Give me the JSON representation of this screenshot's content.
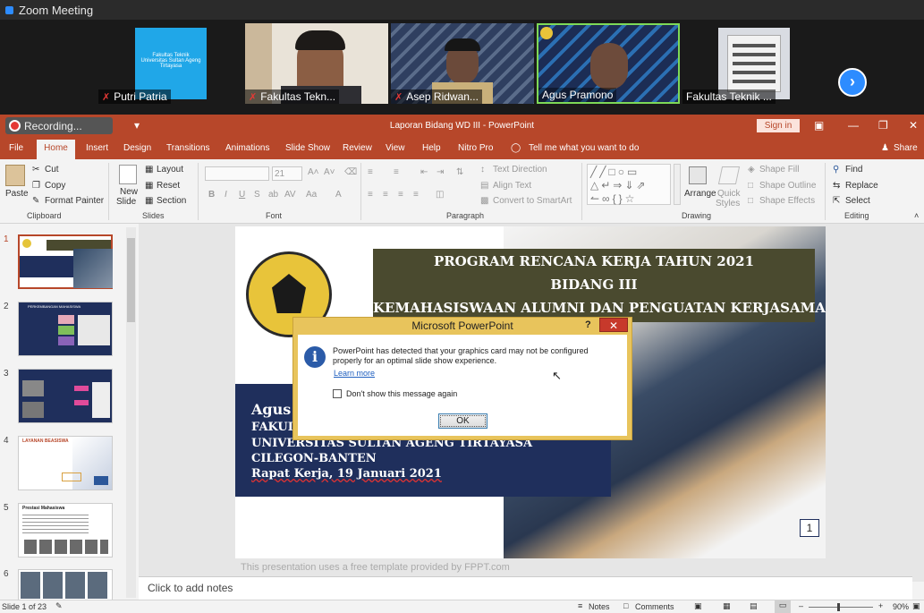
{
  "zoom": {
    "title": "Zoom Meeting",
    "participants": [
      {
        "name": "Putri Patria",
        "slide_text": "Fakultas Teknik Universitas Sultan Ageng Tirtayasa"
      },
      {
        "name": "Fakultas Tekn..."
      },
      {
        "name": "Asep Ridwan..."
      },
      {
        "name": "Agus Pramono"
      },
      {
        "name": "Fakultas Teknik ..."
      }
    ]
  },
  "powerpoint": {
    "recording_label": "Recording...",
    "window_title": "Laporan Bidang WD III  -  PowerPoint",
    "sign_in": "Sign in",
    "tabs": [
      "File",
      "Home",
      "Insert",
      "Design",
      "Transitions",
      "Animations",
      "Slide Show",
      "Review",
      "View",
      "Help",
      "Nitro Pro"
    ],
    "tell_me": "Tell me what you want to do",
    "share": "Share",
    "ribbon": {
      "clipboard": {
        "label": "Clipboard",
        "paste": "Paste",
        "cut": "Cut",
        "copy": "Copy",
        "format_painter": "Format Painter"
      },
      "slides": {
        "label": "Slides",
        "new_slide": "New",
        "new_slide2": "Slide",
        "layout": "Layout",
        "reset": "Reset",
        "section": "Section"
      },
      "font": {
        "label": "Font",
        "size": "21"
      },
      "paragraph": {
        "label": "Paragraph",
        "text_direction": "Text Direction",
        "align_text": "Align Text",
        "smartart": "Convert to SmartArt"
      },
      "drawing": {
        "label": "Drawing",
        "arrange": "Arrange",
        "quick_styles": "Quick",
        "quick_styles2": "Styles",
        "shape_fill": "Shape Fill",
        "shape_outline": "Shape Outline",
        "shape_effects": "Shape Effects"
      },
      "editing": {
        "label": "Editing",
        "find": "Find",
        "replace": "Replace",
        "select": "Select"
      }
    },
    "thumbnails": [
      "1",
      "2",
      "3",
      "4",
      "5",
      "6"
    ],
    "thumb_titles": {
      "t2": "PERKEMBANGAN MAHASISWA",
      "t4": "LAYANAN BEASISWA",
      "t5": "Prestasi Mahasiswa"
    },
    "slide": {
      "title1": "PROGRAM RENCANA KERJA  TAHUN  2021",
      "title2": "BIDANG III",
      "title3": "KEMAHASISWAAN ALUMNI DAN PENGUATAN KERJASAMA",
      "line1": "Agus P",
      "line2": "FAKUL",
      "line3": "UNIVERSITAS SULTAN AGENG TIRTAYASA",
      "line4": "CILEGON-BANTEN",
      "line5": "Rapat Kerja, 19 Januari 2021",
      "page_number": "1",
      "footer": "This presentation uses a free template provided by FPPT.com"
    },
    "notes_placeholder": "Click to add notes",
    "status": {
      "slide_info": "Slide 1 of 23",
      "notes": "Notes",
      "comments": "Comments",
      "zoom": "90%"
    },
    "dialog": {
      "title": "Microsoft PowerPoint",
      "message": "PowerPoint has detected that your graphics card may not be configured properly for an optimal slide show experience.",
      "learn_more": "Learn more",
      "checkbox_label": "Don't show this message again",
      "ok": "OK"
    }
  },
  "colors": {
    "accent": "#b7472a",
    "zoom_blue": "#2d8cff",
    "slide_navy": "#1f2f5c",
    "slide_olive": "#4a4a2f"
  }
}
